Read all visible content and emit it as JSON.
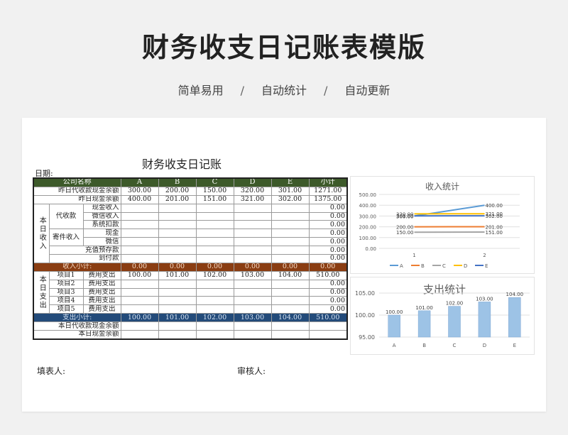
{
  "hero": {
    "title": "财务收支日记账表模版",
    "taglines": [
      "简单易用",
      "自动统计",
      "自动更新"
    ],
    "separator": "/"
  },
  "sheet": {
    "title": "财务收支日记账",
    "date_label": "日期:"
  },
  "table": {
    "headers": [
      "公司名称",
      "A",
      "B",
      "C",
      "D",
      "E",
      "小计"
    ],
    "prev_agency_balance": {
      "label": "昨日代收款现金余额",
      "values": [
        "300.00",
        "200.00",
        "150.00",
        "320.00",
        "301.00",
        "1271.00"
      ]
    },
    "prev_cash_balance": {
      "label": "昨日现金余额",
      "values": [
        "400.00",
        "201.00",
        "151.00",
        "321.00",
        "302.00",
        "1375.00"
      ]
    },
    "income_group": "本日收入",
    "agency_label": "代收款",
    "agency_items": [
      "现金收入",
      "微信收入",
      "系统扣款"
    ],
    "mail_label": "寄件收入",
    "mail_items": [
      "现金",
      "微信"
    ],
    "prepay_label": "充值预存款",
    "cod_label": "到付款",
    "zero": "0.00",
    "income_subtotal": {
      "label": "收入小计:",
      "values": [
        "0.00",
        "0.00",
        "0.00",
        "0.00",
        "0.00",
        "0.00"
      ]
    },
    "expense_group": "本日支出",
    "expense_items": [
      {
        "name": "项目1",
        "type": "费用支出",
        "values": [
          "100.00",
          "101.00",
          "102.00",
          "103.00",
          "104.00",
          "510.00"
        ]
      },
      {
        "name": "项目2",
        "type": "费用支出",
        "values": [
          "",
          "",
          "",
          "",
          "",
          "0.00"
        ]
      },
      {
        "name": "项目3",
        "type": "费用支出",
        "values": [
          "",
          "",
          "",
          "",
          "",
          "0.00"
        ]
      },
      {
        "name": "项目4",
        "type": "费用支出",
        "values": [
          "",
          "",
          "",
          "",
          "",
          "0.00"
        ]
      },
      {
        "name": "项目5",
        "type": "费用支出",
        "values": [
          "",
          "",
          "",
          "",
          "",
          "0.00"
        ]
      }
    ],
    "expense_subtotal": {
      "label": "支出小计:",
      "values": [
        "100.00",
        "101.00",
        "102.00",
        "103.00",
        "104.00",
        "510.00"
      ]
    },
    "today_agency_balance": "本日代收款现金余额",
    "today_cash_balance": "本日现金余额"
  },
  "signatures": {
    "filler": "填表人:",
    "reviewer": "审核人:"
  },
  "colors": {
    "header_green": "#3d5a2a",
    "income_brown": "#8a3d12",
    "expense_blue": "#234b7a",
    "bar_blue": "#9dc3e6"
  },
  "chart_data": [
    {
      "type": "line",
      "title": "收入统计",
      "x": [
        "1",
        "2"
      ],
      "ylim": [
        0,
        500
      ],
      "yticks": [
        "0.00",
        "100.00",
        "200.00",
        "300.00",
        "400.00",
        "500.00"
      ],
      "series": [
        {
          "name": "A",
          "color": "#5b9bd5",
          "values": [
            300,
            400
          ],
          "labels": [
            "300.00",
            "400.00"
          ]
        },
        {
          "name": "B",
          "color": "#ed7d31",
          "values": [
            200,
            201
          ],
          "labels": [
            "200.00",
            "201.00"
          ]
        },
        {
          "name": "C",
          "color": "#a5a5a5",
          "values": [
            150,
            151
          ],
          "labels": [
            "150.00",
            "151.00"
          ]
        },
        {
          "name": "D",
          "color": "#ffc000",
          "values": [
            320,
            321
          ],
          "labels": [
            "320.00",
            "321.00"
          ]
        },
        {
          "name": "E",
          "color": "#4472c4",
          "values": [
            301,
            302
          ],
          "labels": [
            "301.00",
            "302.00"
          ]
        }
      ],
      "legend": "bottom",
      "grid": true
    },
    {
      "type": "bar",
      "title": "支出统计",
      "categories": [
        "A",
        "B",
        "C",
        "D",
        "E"
      ],
      "values": [
        100,
        101,
        102,
        103,
        104
      ],
      "labels": [
        "100.00",
        "101.00",
        "102.00",
        "103.00",
        "104.00"
      ],
      "ylim": [
        95,
        105
      ],
      "yticks": [
        "95.00",
        "100.00",
        "105.00"
      ],
      "grid": true
    }
  ]
}
